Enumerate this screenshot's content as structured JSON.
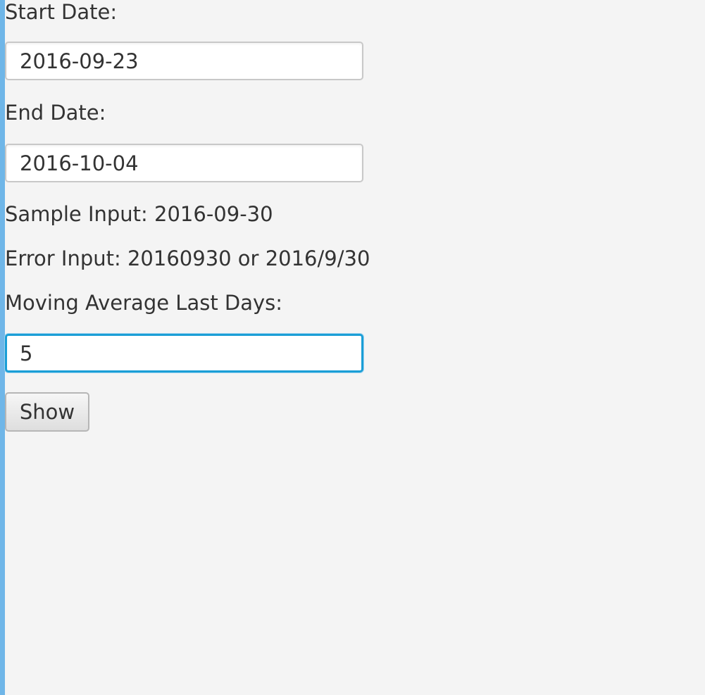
{
  "form": {
    "start_date_label": "Start Date:",
    "start_date_value": "2016-09-23",
    "end_date_label": "End Date:",
    "end_date_value": "2016-10-04",
    "sample_input_text": "Sample Input: 2016-09-30",
    "error_input_text": "Error Input: 20160930 or 2016/9/30",
    "moving_average_label": "Moving Average Last Days:",
    "moving_average_value": "5",
    "show_button_label": "Show"
  },
  "colors": {
    "background": "#f4f4f4",
    "focus_accent": "#1a9ed6",
    "window_edge": "#6fb6e8"
  }
}
